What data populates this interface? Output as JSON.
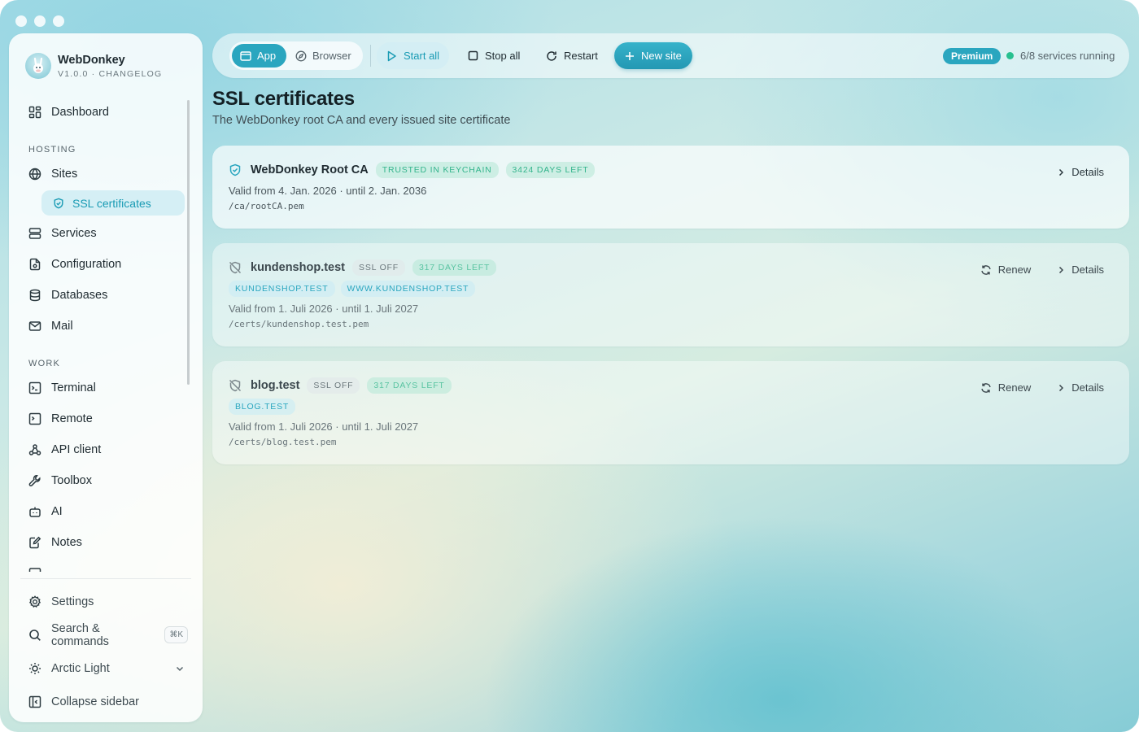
{
  "brand": {
    "name": "WebDonkey",
    "version_line": "V1.0.0 · CHANGELOG"
  },
  "sidebar": {
    "items": [
      {
        "label": "Dashboard",
        "icon": "dashboard-icon"
      },
      {
        "section": "HOSTING"
      },
      {
        "label": "Sites",
        "icon": "globe-icon"
      },
      {
        "label": "SSL certificates",
        "icon": "shield-check-icon",
        "active": true
      },
      {
        "label": "Services",
        "icon": "server-icon"
      },
      {
        "label": "Configuration",
        "icon": "config-file-icon"
      },
      {
        "label": "Databases",
        "icon": "database-icon"
      },
      {
        "label": "Mail",
        "icon": "mail-icon"
      },
      {
        "section": "WORK"
      },
      {
        "label": "Terminal",
        "icon": "terminal-icon"
      },
      {
        "label": "Remote",
        "icon": "remote-terminal-icon"
      },
      {
        "label": "API client",
        "icon": "webhook-icon"
      },
      {
        "label": "Toolbox",
        "icon": "wrench-icon"
      },
      {
        "label": "AI",
        "icon": "bot-icon"
      },
      {
        "label": "Notes",
        "icon": "notes-icon"
      }
    ],
    "settings_label": "Settings",
    "search_label": "Search & commands",
    "search_shortcut": "⌘K",
    "theme_label": "Arctic Light",
    "collapse_label": "Collapse sidebar"
  },
  "toolbar": {
    "app_label": "App",
    "browser_label": "Browser",
    "start_all": "Start all",
    "stop_all": "Stop all",
    "restart": "Restart",
    "new_site": "New site",
    "premium": "Premium",
    "status_text": "6/8 services running",
    "status_color": "#27c08f"
  },
  "page": {
    "title": "SSL certificates",
    "subtitle": "The WebDonkey root CA and every issued site certificate"
  },
  "certificates": [
    {
      "name": "WebDonkey Root CA",
      "badges": [
        "TRUSTED IN KEYCHAIN",
        "3424 DAYS LEFT"
      ],
      "validity": "Valid from 4. Jan. 2026 · until 2. Jan. 2036",
      "path": "/ca/rootCA.pem",
      "details": "Details"
    },
    {
      "name": "kundenshop.test",
      "badges": [
        "SSL OFF",
        "317 DAYS LEFT"
      ],
      "domains": [
        "KUNDENSHOP.TEST",
        "WWW.KUNDENSHOP.TEST"
      ],
      "validity": "Valid from 1. Juli 2026 · until 1. Juli 2027",
      "path": "/certs/kundenshop.test.pem",
      "renew": "Renew",
      "details": "Details"
    },
    {
      "name": "blog.test",
      "badges": [
        "SSL OFF",
        "317 DAYS LEFT"
      ],
      "domains": [
        "BLOG.TEST"
      ],
      "validity": "Valid from 1. Juli 2026 · until 1. Juli 2027",
      "path": "/certs/blog.test.pem",
      "renew": "Renew",
      "details": "Details"
    }
  ]
}
